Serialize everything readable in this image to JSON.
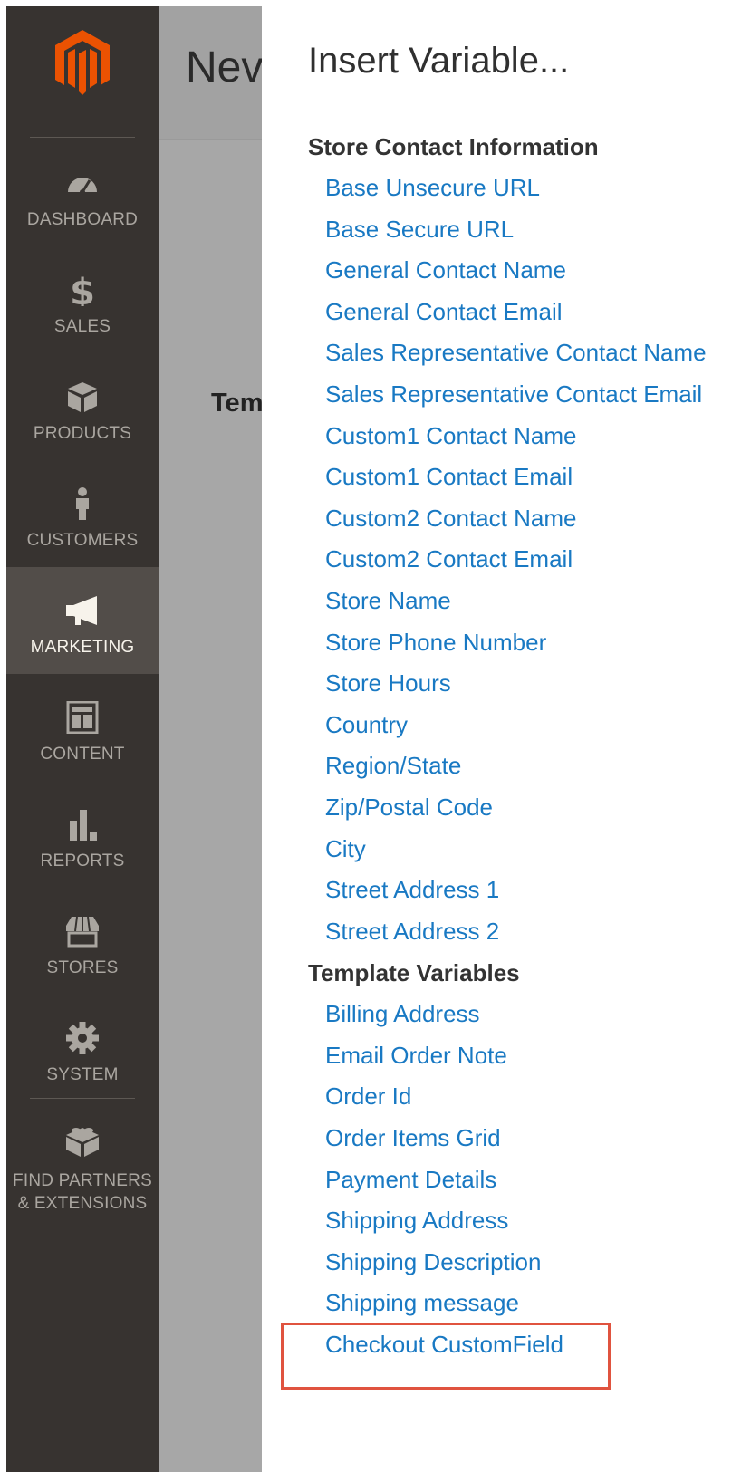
{
  "sidebar": {
    "items": [
      {
        "label": "DASHBOARD",
        "icon": "dashboard-icon"
      },
      {
        "label": "SALES",
        "icon": "dollar-icon"
      },
      {
        "label": "PRODUCTS",
        "icon": "box-icon"
      },
      {
        "label": "CUSTOMERS",
        "icon": "person-icon"
      },
      {
        "label": "MARKETING",
        "icon": "megaphone-icon",
        "active": true
      },
      {
        "label": "CONTENT",
        "icon": "layout-icon"
      },
      {
        "label": "REPORTS",
        "icon": "bar-chart-icon"
      },
      {
        "label": "STORES",
        "icon": "storefront-icon"
      },
      {
        "label": "SYSTEM",
        "icon": "gear-icon"
      },
      {
        "label_line1": "FIND PARTNERS",
        "label_line2": "& EXTENSIONS",
        "icon": "blocks-icon"
      }
    ]
  },
  "page": {
    "title_fragment": "Nev",
    "field_label_fragment": "Tem"
  },
  "modal": {
    "title": "Insert Variable...",
    "groups": [
      {
        "heading": "Store Contact Information",
        "items": [
          "Base Unsecure URL",
          "Base Secure URL",
          "General Contact Name",
          "General Contact Email",
          "Sales Representative Contact Name",
          "Sales Representative Contact Email",
          "Custom1 Contact Name",
          "Custom1 Contact Email",
          "Custom2 Contact Name",
          "Custom2 Contact Email",
          "Store Name",
          "Store Phone Number",
          "Store Hours",
          "Country",
          "Region/State",
          "Zip/Postal Code",
          "City",
          "Street Address 1",
          "Street Address 2"
        ]
      },
      {
        "heading": "Template Variables",
        "items": [
          "Billing Address",
          "Email Order Note",
          "Order Id",
          "Order Items Grid",
          "Payment Details",
          "Shipping Address",
          "Shipping Description",
          "Shipping message",
          "Checkout CustomField"
        ]
      }
    ]
  },
  "colors": {
    "sidebar_bg": "#373330",
    "sidebar_active_bg": "#524d49",
    "link": "#1979c3",
    "brand_orange": "#eb5202",
    "highlight": "#e0533f"
  }
}
